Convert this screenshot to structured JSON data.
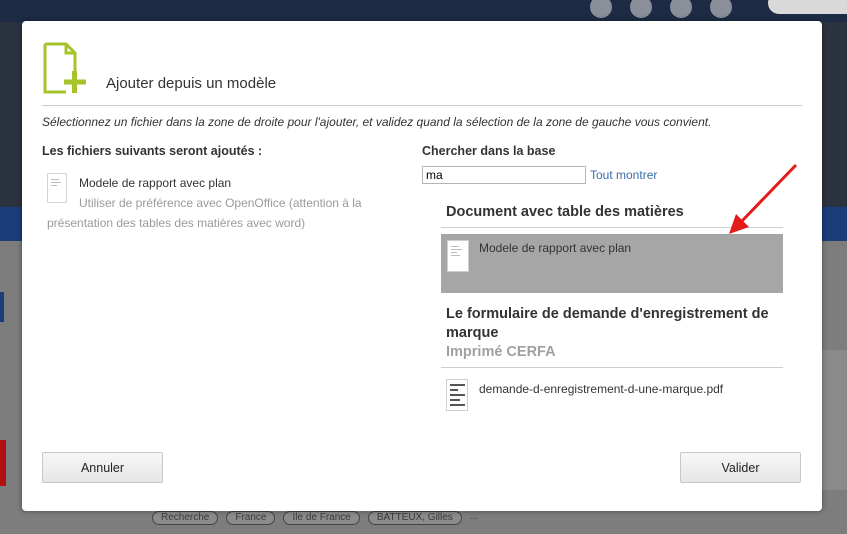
{
  "background": {
    "tags": [
      "Recherche",
      "France",
      "Ile de France",
      "BATTEUX, Gilles",
      "..."
    ]
  },
  "dialog": {
    "title": "Ajouter depuis un modèle",
    "instruction": "Sélectionnez un fichier dans la zone de droite pour l'ajouter, et validez quand la sélection de la zone de gauche vous convient.",
    "left": {
      "heading": "Les fichiers suivants seront ajoutés :",
      "files": [
        {
          "name": "Modele de rapport avec plan",
          "description": "Utiliser de préférence avec OpenOffice (attention à la présentation des tables des matières avec word)"
        }
      ]
    },
    "right": {
      "search_label": "Chercher dans la base",
      "search_value": "ma",
      "show_all": "Tout montrer",
      "groups": [
        {
          "title": "Document avec table des matières",
          "subtitle": "",
          "items": [
            {
              "name": "Modele de rapport avec plan",
              "selected": true
            }
          ]
        },
        {
          "title": "Le formulaire de demande d'enregistrement de marque",
          "subtitle": "Imprimé CERFA",
          "items": [
            {
              "name": "demande-d-enregistrement-d-une-marque.pdf",
              "selected": false
            }
          ]
        }
      ]
    },
    "buttons": {
      "cancel": "Annuler",
      "validate": "Valider"
    }
  },
  "colors": {
    "accent_icon": "#a5c42a",
    "selected_row": "#a6a6a6",
    "link": "#3a6ea5",
    "annotation_arrow": "#e31b1b"
  },
  "icons": {
    "dialog": "add-document-icon",
    "files": "document-icon",
    "pdf": "pdf-document-icon"
  }
}
